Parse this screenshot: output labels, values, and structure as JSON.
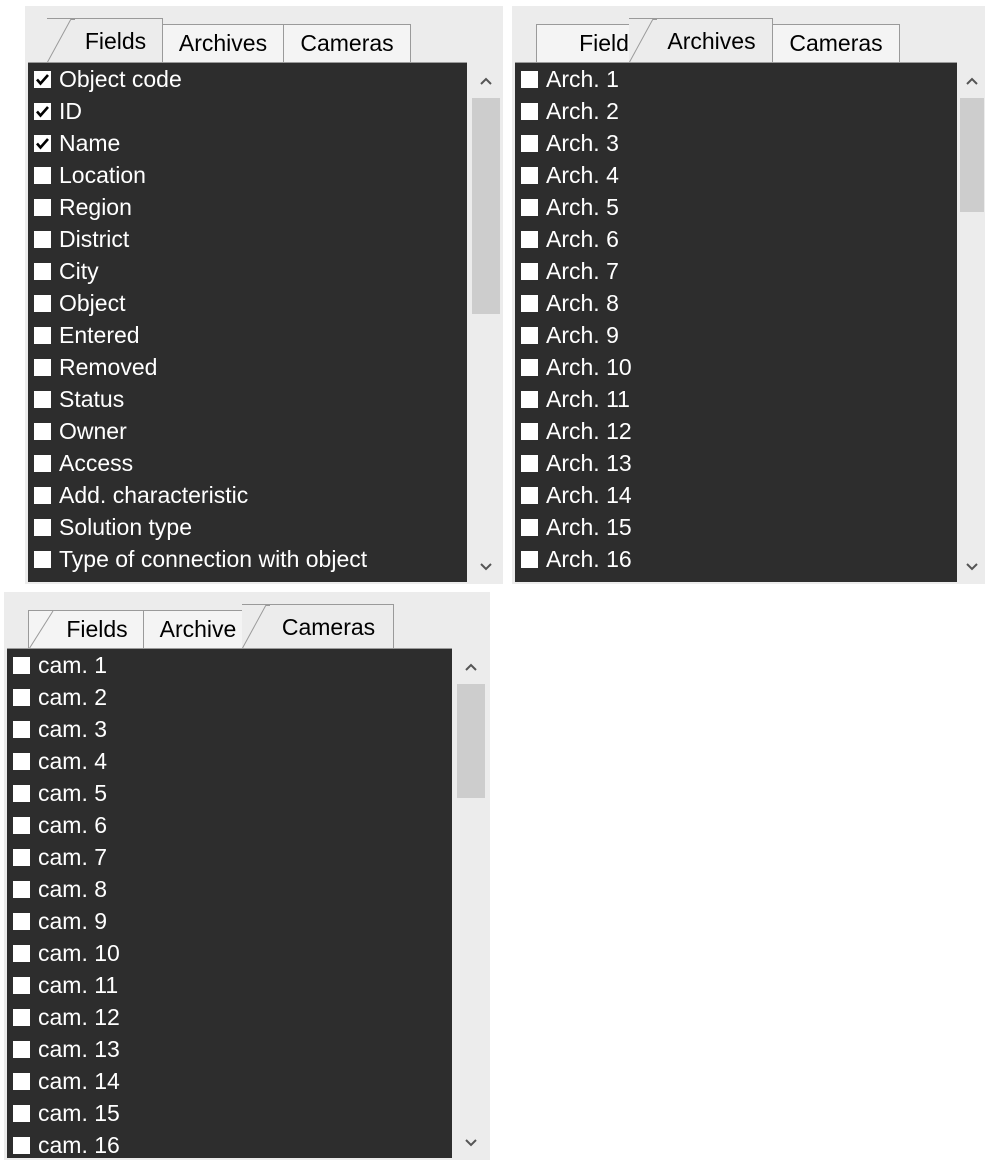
{
  "tabs": {
    "fields": "Fields",
    "archives": "Archives",
    "cameras": "Cameras",
    "fields_truncated": "Field",
    "archives_truncated": "Archive"
  },
  "panel_fields": {
    "active_tab": "Fields",
    "items": [
      {
        "label": "Object code",
        "checked": true
      },
      {
        "label": "ID",
        "checked": true
      },
      {
        "label": "Name",
        "checked": true
      },
      {
        "label": "Location",
        "checked": false
      },
      {
        "label": "Region",
        "checked": false
      },
      {
        "label": "District",
        "checked": false
      },
      {
        "label": "City",
        "checked": false
      },
      {
        "label": "Object",
        "checked": false
      },
      {
        "label": "Entered",
        "checked": false
      },
      {
        "label": "Removed",
        "checked": false
      },
      {
        "label": "Status",
        "checked": false
      },
      {
        "label": "Owner",
        "checked": false
      },
      {
        "label": "Access",
        "checked": false
      },
      {
        "label": "Add. characteristic",
        "checked": false
      },
      {
        "label": "Solution type",
        "checked": false
      },
      {
        "label": "Type of connection with object",
        "checked": false
      }
    ]
  },
  "panel_archives": {
    "active_tab": "Archives",
    "items": [
      {
        "label": "Arch. 1",
        "checked": false
      },
      {
        "label": "Arch. 2",
        "checked": false
      },
      {
        "label": "Arch. 3",
        "checked": false
      },
      {
        "label": "Arch. 4",
        "checked": false
      },
      {
        "label": "Arch. 5",
        "checked": false
      },
      {
        "label": "Arch. 6",
        "checked": false
      },
      {
        "label": "Arch. 7",
        "checked": false
      },
      {
        "label": "Arch. 8",
        "checked": false
      },
      {
        "label": "Arch. 9",
        "checked": false
      },
      {
        "label": "Arch. 10",
        "checked": false
      },
      {
        "label": "Arch. 11",
        "checked": false
      },
      {
        "label": "Arch. 12",
        "checked": false
      },
      {
        "label": "Arch. 13",
        "checked": false
      },
      {
        "label": "Arch. 14",
        "checked": false
      },
      {
        "label": "Arch. 15",
        "checked": false
      },
      {
        "label": "Arch. 16",
        "checked": false
      }
    ]
  },
  "panel_cameras": {
    "active_tab": "Cameras",
    "items": [
      {
        "label": "cam. 1",
        "checked": false
      },
      {
        "label": "cam. 2",
        "checked": false
      },
      {
        "label": "cam. 3",
        "checked": false
      },
      {
        "label": "cam. 4",
        "checked": false
      },
      {
        "label": "cam. 5",
        "checked": false
      },
      {
        "label": "cam. 6",
        "checked": false
      },
      {
        "label": "cam. 7",
        "checked": false
      },
      {
        "label": "cam. 8",
        "checked": false
      },
      {
        "label": "cam. 9",
        "checked": false
      },
      {
        "label": "cam. 10",
        "checked": false
      },
      {
        "label": "cam. 11",
        "checked": false
      },
      {
        "label": "cam. 12",
        "checked": false
      },
      {
        "label": "cam. 13",
        "checked": false
      },
      {
        "label": "cam. 14",
        "checked": false
      },
      {
        "label": "cam. 15",
        "checked": false
      },
      {
        "label": "cam. 16",
        "checked": false
      }
    ]
  },
  "colors": {
    "list_background": "#2d2d2d",
    "list_text": "#ffffff",
    "panel_background": "#ececec",
    "scroll_thumb": "#cdcdcd"
  },
  "icons": {
    "scroll_up": "chevron-up-icon",
    "scroll_down": "chevron-down-icon",
    "checkbox_checked": "checkmark-icon"
  }
}
